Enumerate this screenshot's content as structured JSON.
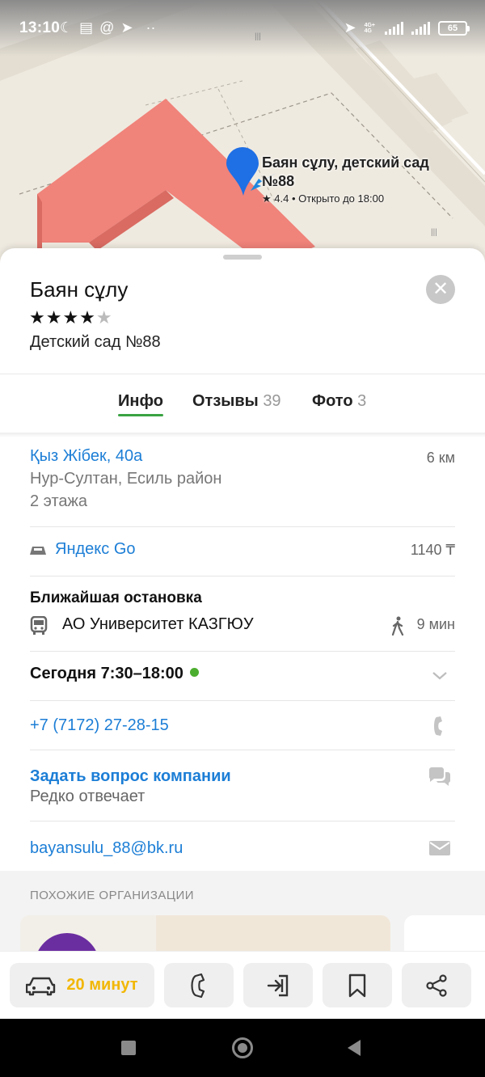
{
  "status_bar": {
    "time": "13:10",
    "network_label_top": "4G+",
    "network_label_bottom": "4G",
    "battery": "65"
  },
  "map": {
    "pin_label_line1": "Баян сұлу, детский сад",
    "pin_label_line2": "№88",
    "pin_rating_line": "★ 4.4 • Открыто до 18:00"
  },
  "place": {
    "title": "Баян сұлу",
    "rating_stars": "★★★★",
    "rating_half_star": "★",
    "subtitle": "Детский сад №88"
  },
  "tabs": [
    {
      "label": "Инфо",
      "count": ""
    },
    {
      "label": "Отзывы",
      "count": "39"
    },
    {
      "label": "Фото",
      "count": "3"
    }
  ],
  "address": {
    "street": "Қыз Жібек, 40а",
    "distance": "6 км",
    "city": "Нур-Султан, Есиль район",
    "floors": "2 этажа"
  },
  "taxi": {
    "label": "Яндекс Go",
    "price": "1140 ₸"
  },
  "stop": {
    "heading": "Ближайшая остановка",
    "name": "АО Университет КАЗГЮУ",
    "walk_time": "9 мин"
  },
  "hours": {
    "text": "Сегодня 7:30–18:00",
    "status_color": "#4cae2e"
  },
  "phone": {
    "number": "+7 (7172) 27-28-15"
  },
  "question": {
    "label": "Задать вопрос компании",
    "sub": "Редко отвечает"
  },
  "email": {
    "address": "bayansulu_88@bk.ru"
  },
  "similar": {
    "title": "ПОХОЖИЕ ОРГАНИЗАЦИИ"
  },
  "toolbar": {
    "route_label": "20 минут",
    "accent_color": "#f2b705"
  },
  "icons": {
    "close": "close-icon",
    "taxi": "taxi-icon",
    "bus": "bus-icon",
    "walk": "walk-icon",
    "chevron": "chevron-down-icon",
    "phone": "phone-icon",
    "chat": "chat-icon",
    "mail": "mail-icon",
    "car": "car-icon",
    "enter": "entrance-icon",
    "bookmark": "bookmark-icon",
    "share": "share-icon"
  }
}
